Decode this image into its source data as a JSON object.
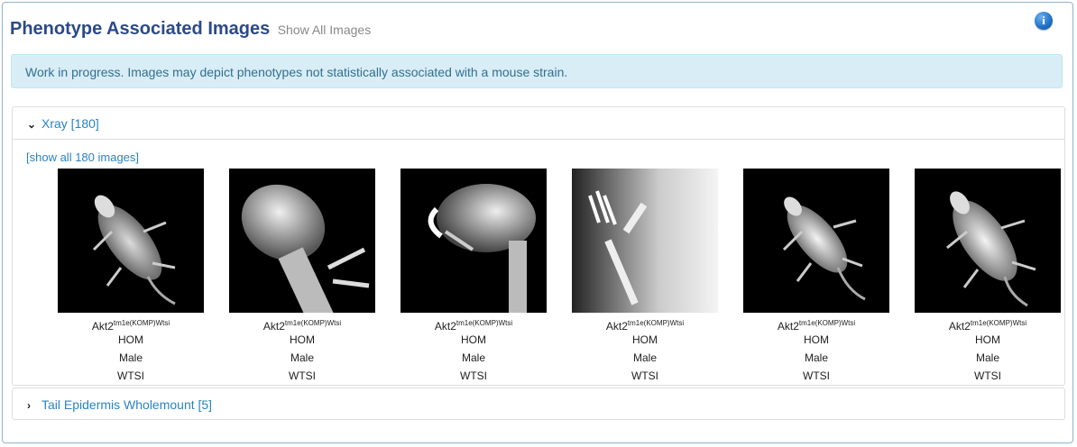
{
  "header": {
    "title": "Phenotype Associated Images",
    "show_all_link": "Show All Images",
    "info_icon": "info-icon"
  },
  "alert": {
    "text": "Work in progress. Images may depict phenotypes not statistically associated with a mouse strain."
  },
  "sections": [
    {
      "label": "Xray [180]",
      "expanded": true,
      "show_all_link": "[show all 180 images]",
      "images": [
        {
          "gene": "Akt2",
          "allele_sup": "tm1e(KOMP)Wtsi",
          "zygosity": "HOM",
          "sex": "Male",
          "center": "WTSI"
        },
        {
          "gene": "Akt2",
          "allele_sup": "tm1e(KOMP)Wtsi",
          "zygosity": "HOM",
          "sex": "Male",
          "center": "WTSI"
        },
        {
          "gene": "Akt2",
          "allele_sup": "tm1e(KOMP)Wtsi",
          "zygosity": "HOM",
          "sex": "Male",
          "center": "WTSI"
        },
        {
          "gene": "Akt2",
          "allele_sup": "tm1e(KOMP)Wtsi",
          "zygosity": "HOM",
          "sex": "Male",
          "center": "WTSI"
        },
        {
          "gene": "Akt2",
          "allele_sup": "tm1e(KOMP)Wtsi",
          "zygosity": "HOM",
          "sex": "Male",
          "center": "WTSI"
        },
        {
          "gene": "Akt2",
          "allele_sup": "tm1e(KOMP)Wtsi",
          "zygosity": "HOM",
          "sex": "Male",
          "center": "WTSI"
        }
      ]
    },
    {
      "label": "Tail Epidermis Wholemount [5]",
      "expanded": false
    }
  ]
}
